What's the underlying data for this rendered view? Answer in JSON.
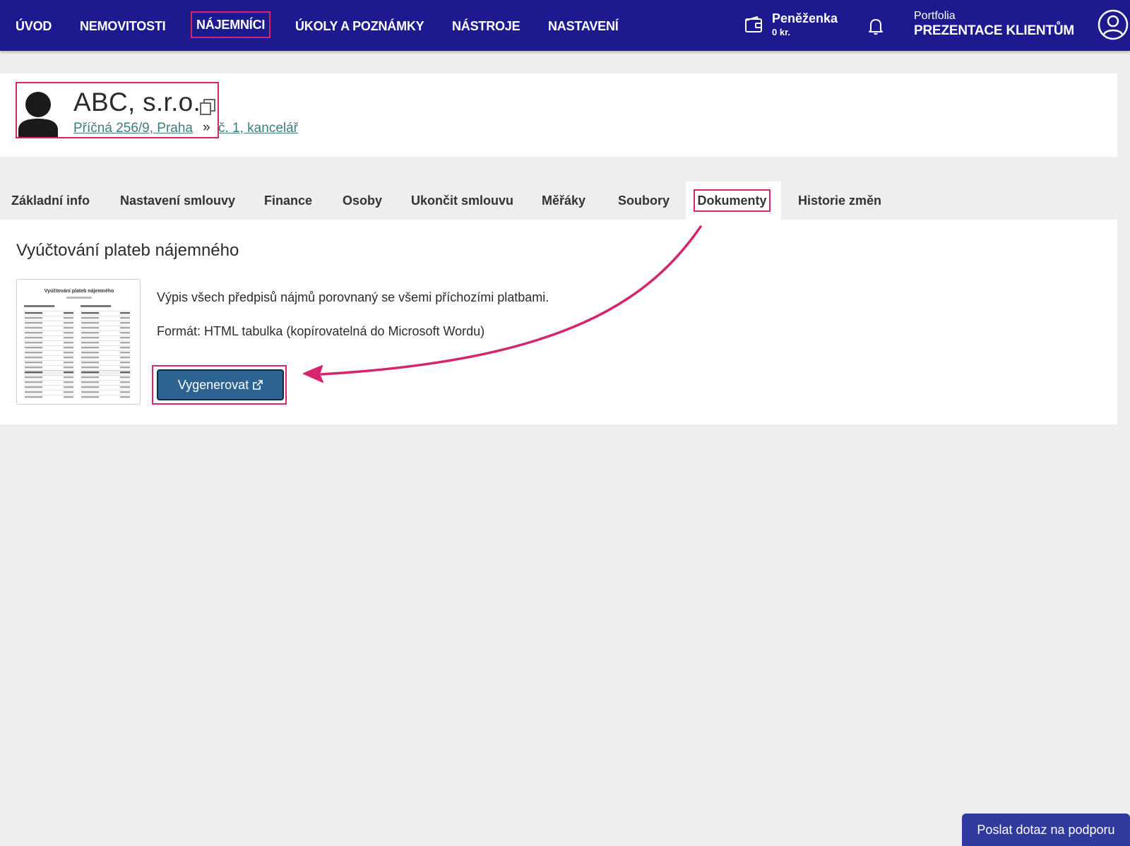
{
  "nav": {
    "items": [
      "Úvod",
      "Nemovitosti",
      "Nájemníci",
      "Úkoly a poznámky",
      "Nástroje",
      "Nastavení"
    ],
    "wallet": {
      "title": "Peněženka",
      "amount": "0 kr."
    },
    "portfolio": {
      "label": "Portfolia",
      "name": "PREZENTACE KLIENTŮM"
    }
  },
  "tenant": {
    "name": "ABC, s.r.o.",
    "breadcrumb": {
      "address": "Příčná 256/9, Praha",
      "separator": "»",
      "unit": "č. 1, kancelář"
    }
  },
  "tabs": [
    "Základní info",
    "Nastavení smlouvy",
    "Finance",
    "Osoby",
    "Ukončit smlouvu",
    "Měřáky",
    "Soubory",
    "Dokumenty",
    "Historie změn"
  ],
  "active_tab": "Dokumenty",
  "document": {
    "title": "Vyúčtování plateb nájemného",
    "description": "Výpis všech předpisů nájmů porovnaný se všemi příchozími platbami.",
    "format": "Formát: HTML tabulka (kopírovatelná do Microsoft Wordu)",
    "button_label": "Vygenerovat",
    "preview": {
      "title": "Vyúčtování plateb nájemného"
    }
  },
  "support_button": "Poslat dotaz na podporu",
  "colors": {
    "nav_bg": "#1d1a8f",
    "highlight": "#d6246e",
    "button": "#2d6390",
    "link": "#3f7c82"
  },
  "icons": [
    "wallet-icon",
    "bell-icon",
    "user-icon",
    "avatar-icon",
    "copy-icon",
    "external-link-icon"
  ]
}
